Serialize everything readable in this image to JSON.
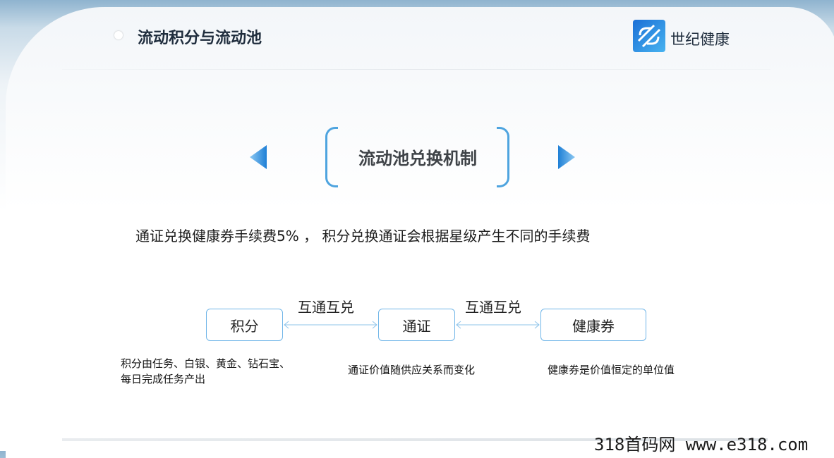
{
  "header": {
    "title": "流动积分与流动池",
    "brand_name": "世纪健康"
  },
  "main": {
    "section_title": "流动池兑换机制",
    "description": "通证兑换健康券手续费5% ， 积分兑换通证会根据星级产生不同的手续费"
  },
  "flow": {
    "nodes": [
      "积分",
      "通证",
      "健康券"
    ],
    "links": [
      "互通互兑",
      "互通互兑"
    ],
    "notes": [
      "积分由任务、白银、黄金、钻石宝、每日完成任务产出",
      "通证价值随供应关系而变化",
      "健康券是价值恒定的单位值"
    ]
  },
  "footer": {
    "watermark": "318首码网  www.e318.com"
  },
  "colors": {
    "accent": "#4ea4df",
    "node_border": "#6fb5e8",
    "logo": "#1b6fd6"
  },
  "icons": [
    "bullet-dot-icon",
    "brand-logo-icon",
    "triangle-left-icon",
    "triangle-right-icon",
    "double-arrow-icon"
  ]
}
